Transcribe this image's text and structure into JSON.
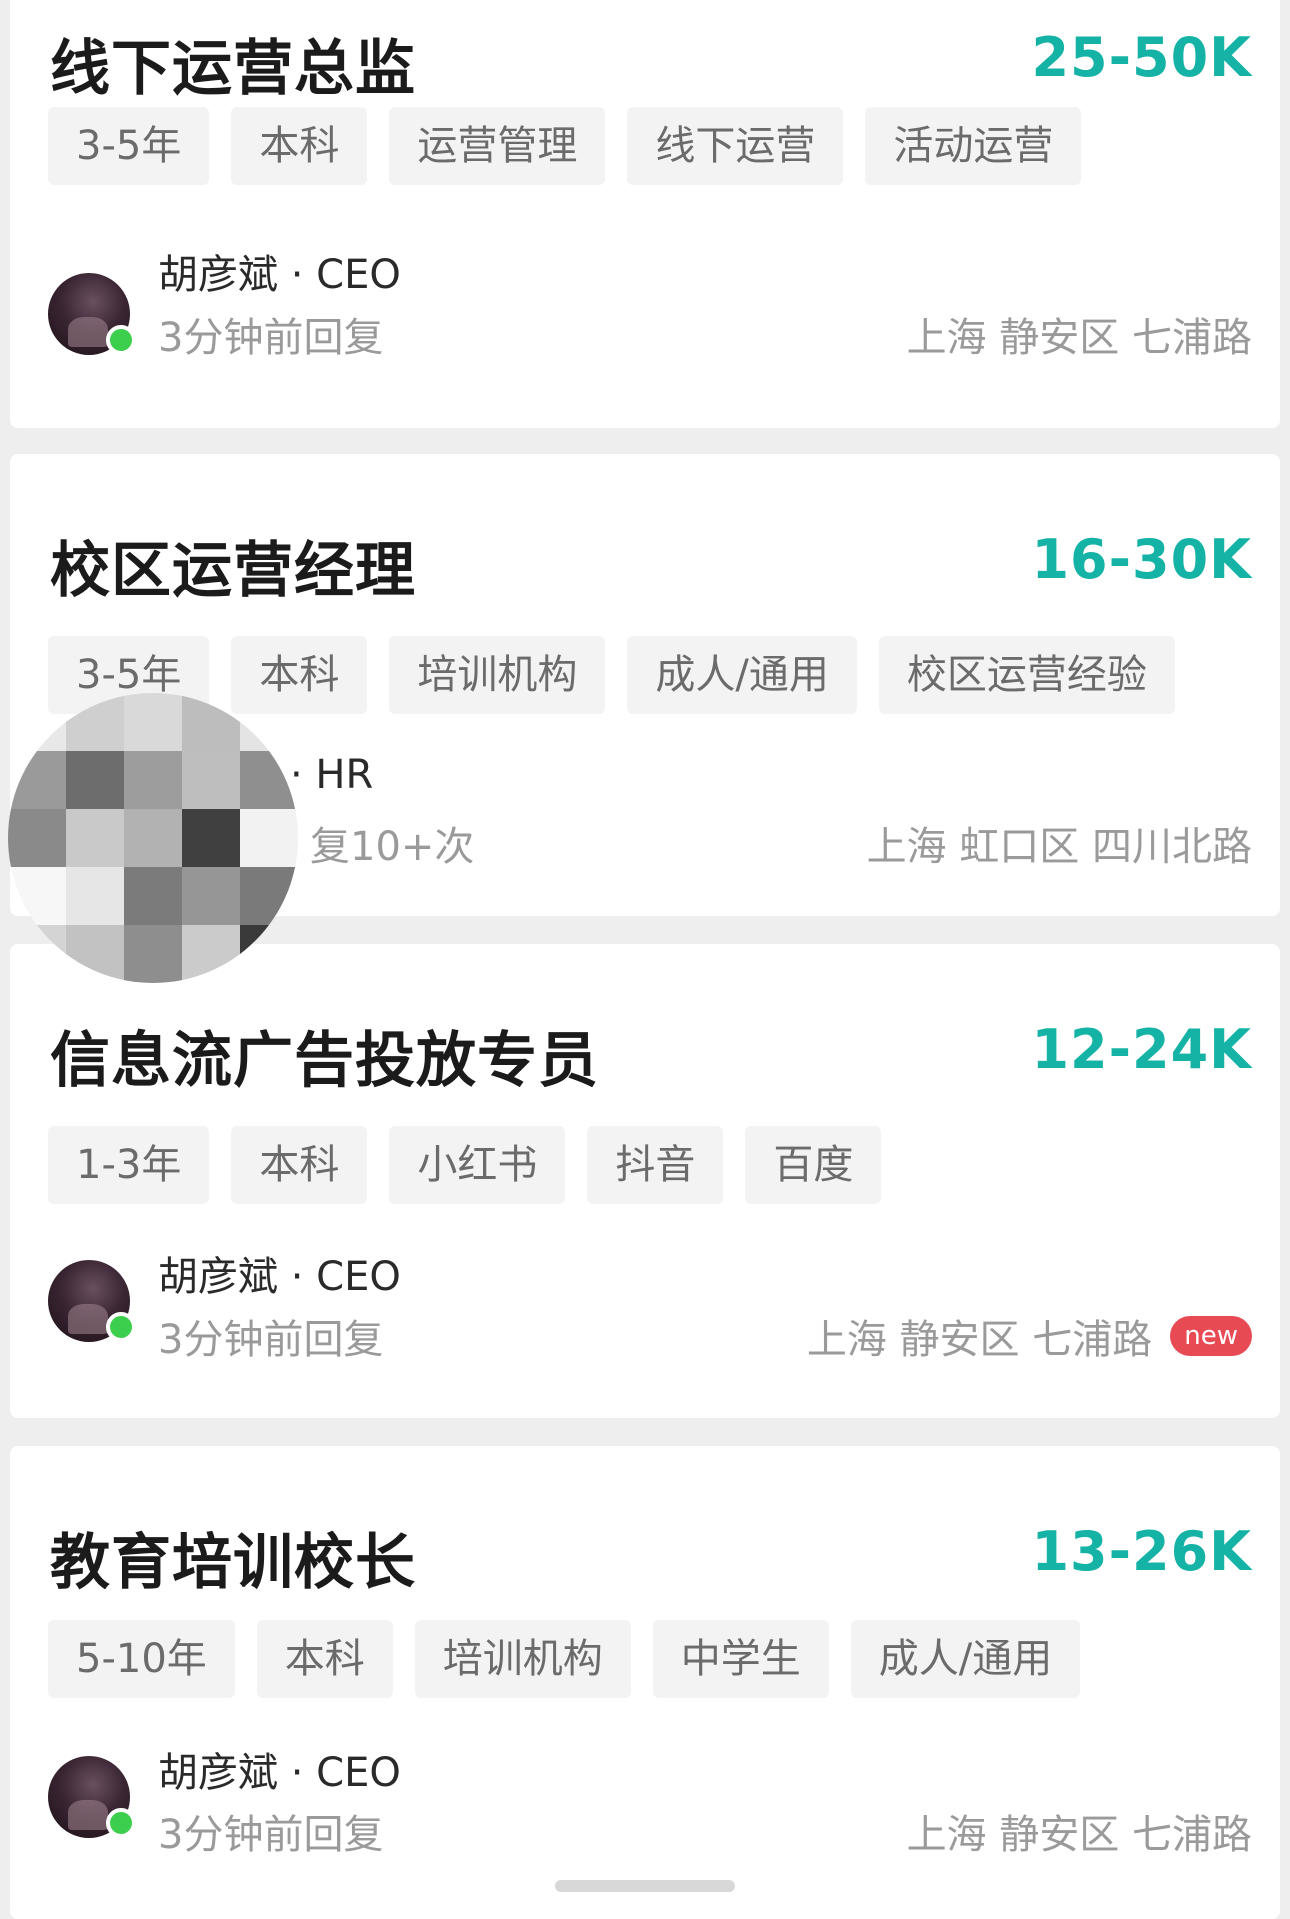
{
  "jobs": [
    {
      "title": "线下运营总监",
      "salary": "25-50K",
      "tags": [
        "3-5年",
        "本科",
        "运营管理",
        "线下运营",
        "活动运营"
      ],
      "recruiter": "胡彦斌 · CEO",
      "reply": "3分钟前回复",
      "location": "上海 静安区 七浦路"
    },
    {
      "title": "校区运营经理",
      "salary": "16-30K",
      "tags": [
        "3-5年",
        "本科",
        "培训机构",
        "成人/通用",
        "校区运营经验"
      ],
      "recruiter": "· HR",
      "reply": "复10+次",
      "location": "上海 虹口区 四川北路"
    },
    {
      "title": "信息流广告投放专员",
      "salary": "12-24K",
      "tags": [
        "1-3年",
        "本科",
        "小红书",
        "抖音",
        "百度"
      ],
      "recruiter": "胡彦斌 · CEO",
      "reply": "3分钟前回复",
      "location": "上海 静安区 七浦路",
      "badge": "new"
    },
    {
      "title": "教育培训校长",
      "salary": "13-26K",
      "tags": [
        "5-10年",
        "本科",
        "培训机构",
        "中学生",
        "成人/通用"
      ],
      "recruiter": "胡彦斌 · CEO",
      "reply": "3分钟前回复",
      "location": "上海 静安区 七浦路"
    }
  ],
  "colors": {
    "salary": "#15b3a6",
    "online_dot": "#3ccf4e",
    "new_badge": "#e84a54",
    "tag_bg": "#f3f3f3"
  },
  "icons": [
    "avatar",
    "online-status-icon",
    "pixelated-avatar"
  ]
}
